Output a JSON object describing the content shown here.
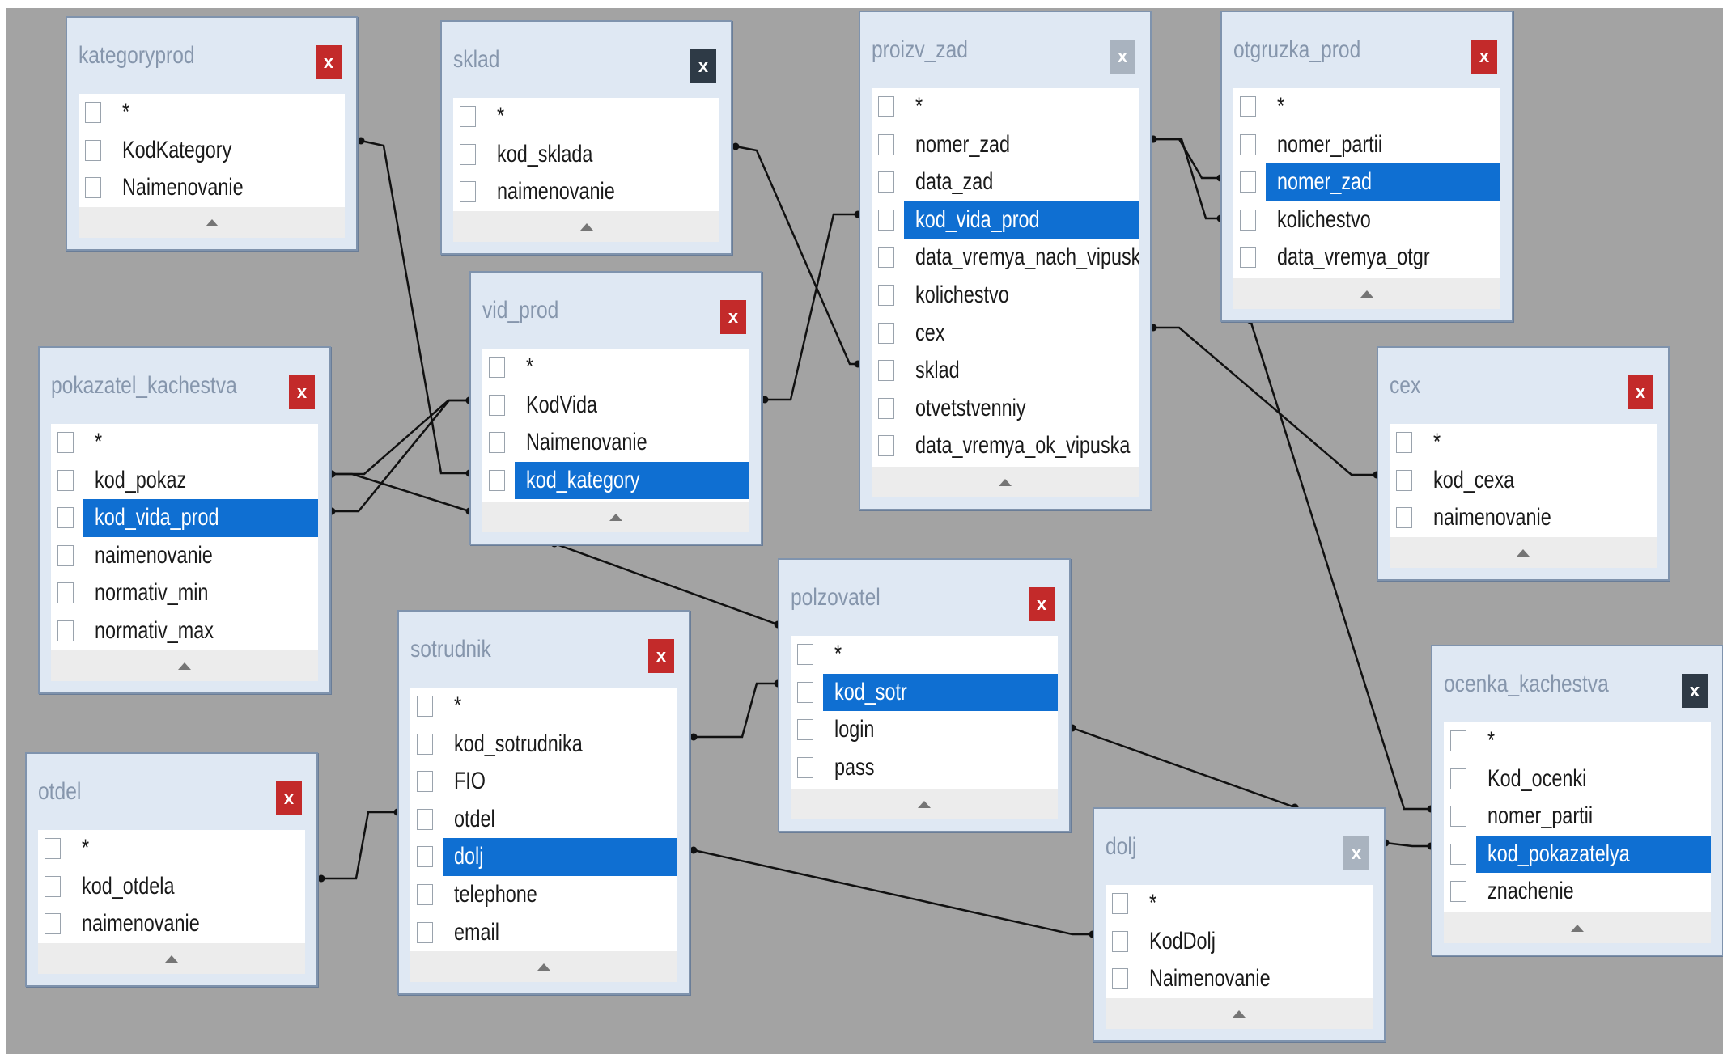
{
  "tables": [
    {
      "id": "kategoryprod",
      "title": "kategoryprod",
      "close": "x",
      "fields": [
        "*",
        "KodKategory",
        "Naimenovanie"
      ],
      "selected": -1,
      "closeStyle": "red"
    },
    {
      "id": "sklad",
      "title": "sklad",
      "close": "x",
      "fields": [
        "*",
        "kod_sklada",
        "naimenovanie"
      ],
      "selected": -1,
      "closeStyle": "dark"
    },
    {
      "id": "proizv_zad",
      "title": "proizv_zad",
      "close": "x",
      "fields": [
        "*",
        "nomer_zad",
        "data_zad",
        "kod_vida_prod",
        "data_vremya_nach_vipuska",
        "kolichestvo",
        "cex",
        "sklad",
        "otvetstvenniy",
        "data_vremya_ok_vipuska"
      ],
      "selected": 3,
      "closeStyle": "grey"
    },
    {
      "id": "otgruzka_prod",
      "title": "otgruzka_prod",
      "close": "x",
      "fields": [
        "*",
        "nomer_partii",
        "nomer_zad",
        "kolichestvo",
        "data_vremya_otgr"
      ],
      "selected": 2,
      "closeStyle": "red"
    },
    {
      "id": "vid_prod",
      "title": "vid_prod",
      "close": "x",
      "fields": [
        "*",
        "KodVida",
        "Naimenovanie",
        "kod_kategory"
      ],
      "selected": 3,
      "closeStyle": "red"
    },
    {
      "id": "pokazatel_kachestva",
      "title": "pokazatel_kachestva",
      "close": "x",
      "fields": [
        "*",
        "kod_pokaz",
        "kod_vida_prod",
        "naimenovanie",
        "normativ_min",
        "normativ_max"
      ],
      "selected": 2,
      "closeStyle": "red"
    },
    {
      "id": "cex",
      "title": "cex",
      "close": "x",
      "fields": [
        "*",
        "kod_cexa",
        "naimenovanie"
      ],
      "selected": -1,
      "closeStyle": "red"
    },
    {
      "id": "polzovatel",
      "title": "polzovatel",
      "close": "x",
      "fields": [
        "*",
        "kod_sotr",
        "login",
        "pass"
      ],
      "selected": 1,
      "closeStyle": "red"
    },
    {
      "id": "sotrudnik",
      "title": "sotrudnik",
      "close": "x",
      "fields": [
        "*",
        "kod_sotrudnika",
        "FIO",
        "otdel",
        "dolj",
        "telephone",
        "email"
      ],
      "selected": 4,
      "closeStyle": "red"
    },
    {
      "id": "otdel",
      "title": "otdel",
      "close": "x",
      "fields": [
        "*",
        "kod_otdela",
        "naimenovanie"
      ],
      "selected": -1,
      "closeStyle": "red"
    },
    {
      "id": "ocenka_kachestva",
      "title": "ocenka_kachestva",
      "close": "x",
      "fields": [
        "*",
        "Kod_ocenki",
        "nomer_partii",
        "kod_pokazatelya",
        "znachenie"
      ],
      "selected": 3,
      "closeStyle": "dark"
    },
    {
      "id": "dolj",
      "title": "dolj",
      "close": "x",
      "fields": [
        "*",
        "KodDolj",
        "Naimenovanie"
      ],
      "selected": -1,
      "closeStyle": "grey"
    }
  ],
  "colors": {
    "canvas": "#a3a3a3",
    "window": "#dfe8f3",
    "selection": "#0f6fd2",
    "close_red": "#c32a2a"
  }
}
